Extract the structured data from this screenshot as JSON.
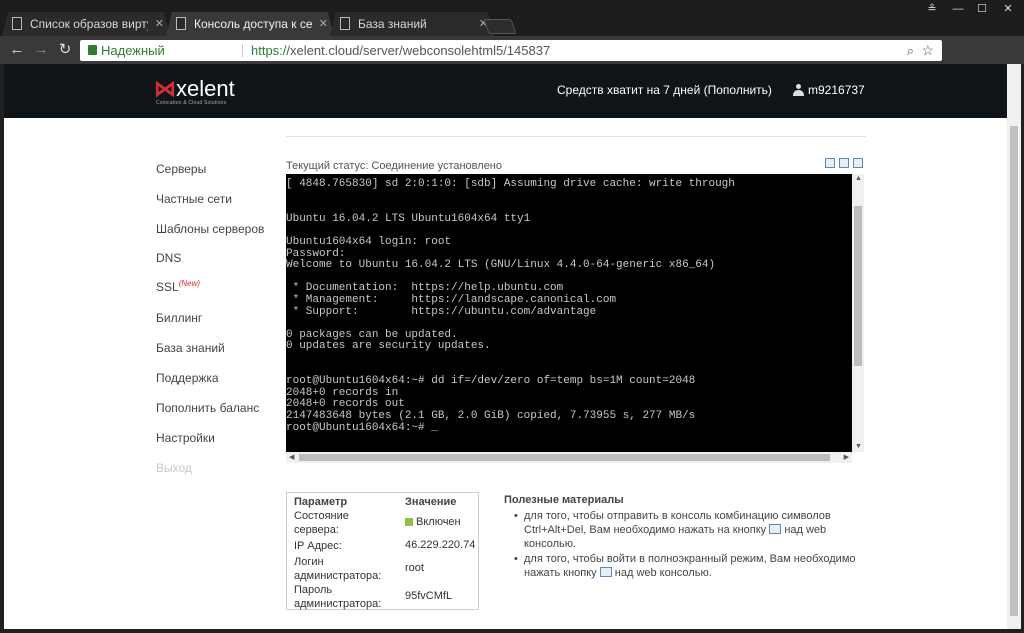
{
  "browser": {
    "tabs": [
      {
        "label": "Список образов виртуа"
      },
      {
        "label": "Консоль доступа к серв"
      },
      {
        "label": "База знаний"
      }
    ],
    "secure_label": "Надежный",
    "url_prefix": "https://",
    "url_rest": "xelent.cloud/server/webconsolehtml5/145837"
  },
  "header": {
    "logo_text": "xelent",
    "logo_tagline": "Colocation & Cloud Solutions",
    "balance": "Средств хватит на 7 дней (Пополнить)",
    "username": "m9216737"
  },
  "sidebar": {
    "items": [
      {
        "label": "Серверы"
      },
      {
        "label": "Частные сети"
      },
      {
        "label": "Шаблоны серверов"
      },
      {
        "label": "DNS"
      },
      {
        "label": "SSL",
        "badge": "(New)"
      },
      {
        "label": "Биллинг"
      },
      {
        "label": "База знаний"
      },
      {
        "label": "Поддержка"
      },
      {
        "label": "Пополнить баланс"
      },
      {
        "label": "Настройки"
      },
      {
        "label": "Выход"
      }
    ]
  },
  "console": {
    "status": "Текущий статус: Соединение установлено",
    "lines": [
      "[ 4848.765830] sd 2:0:1:0: [sdb] Assuming drive cache: write through",
      "",
      "",
      "Ubuntu 16.04.2 LTS Ubuntu1604x64 tty1",
      "",
      "Ubuntu1604x64 login: root",
      "Password:",
      "Welcome to Ubuntu 16.04.2 LTS (GNU/Linux 4.4.0-64-generic x86_64)",
      "",
      " * Documentation:  https://help.ubuntu.com",
      " * Management:     https://landscape.canonical.com",
      " * Support:        https://ubuntu.com/advantage",
      "",
      "0 packages can be updated.",
      "0 updates are security updates.",
      "",
      "",
      "root@Ubuntu1604x64:~# dd if=/dev/zero of=temp bs=1M count=2048",
      "2048+0 records in",
      "2048+0 records out",
      "2147483648 bytes (2.1 GB, 2.0 GiB) copied, 7.73955 s, 277 MB/s",
      "root@Ubuntu1604x64:~# _"
    ]
  },
  "params": {
    "header_param": "Параметр",
    "header_value": "Значение",
    "rows": [
      {
        "key": "Состояние сервера:",
        "value": "Включен"
      },
      {
        "key": "IP Адрес:",
        "value": "46.229.220.74"
      },
      {
        "key": "Логин администратора:",
        "value": "root"
      },
      {
        "key": "Пароль администратора:",
        "value": "95fvCMfL"
      }
    ],
    "status_color": "#8bc34a"
  },
  "useful": {
    "title": "Полезные материалы",
    "item1_a": "для того, чтобы отправить в консоль комбинацию символов Ctrl+Alt+Del, Вам необходимо нажать на кнопку",
    "item1_b": "над web консолью.",
    "item2_a": "для того, чтобы войти в полноэкранный режим, Вам необходимо нажать кнопку",
    "item2_b": "над web консолью."
  }
}
